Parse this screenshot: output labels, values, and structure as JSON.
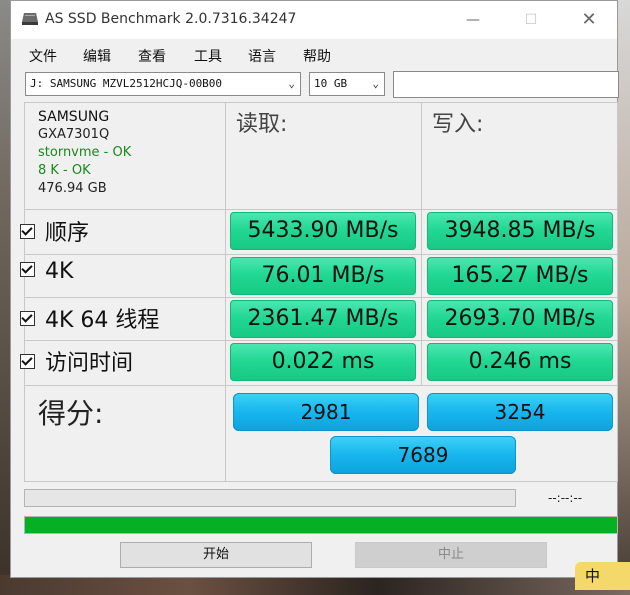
{
  "window": {
    "title": "AS SSD Benchmark 2.0.7316.34247",
    "minimize": "—",
    "maximize": "☐",
    "close": "✕"
  },
  "menu": [
    "文件",
    "编辑",
    "查看",
    "工具",
    "语言",
    "帮助"
  ],
  "toolbar": {
    "drive": "J: SAMSUNG MZVL2512HCJQ-00B00",
    "size": "10 GB",
    "input_value": ""
  },
  "device": {
    "name": "SAMSUNG",
    "firmware": "GXA7301Q",
    "driver_status": "stornvme - OK",
    "alignment_status": "8 K - OK",
    "capacity": "476.94 GB"
  },
  "columns": {
    "read": "读取:",
    "write": "写入:"
  },
  "tests": [
    {
      "label": "顺序",
      "read": "5433.90 MB/s",
      "write": "3948.85 MB/s"
    },
    {
      "label": "4K",
      "read": "76.01 MB/s",
      "write": "165.27 MB/s"
    },
    {
      "label": "4K 64 线程",
      "read": "2361.47 MB/s",
      "write": "2693.70 MB/s"
    },
    {
      "label": "访问时间",
      "read": "0.022 ms",
      "write": "0.246 ms"
    }
  ],
  "score": {
    "label": "得分:",
    "read": "2981",
    "write": "3254",
    "total": "7689"
  },
  "status": {
    "elapsed": "--:--:--",
    "progress_percent": 100
  },
  "buttons": {
    "start": "开始",
    "stop": "中止"
  },
  "taskbar": {
    "ime": "中"
  },
  "colors": {
    "result_green": "#22d894",
    "score_blue": "#17b6ee",
    "progress_green": "#06b025"
  }
}
